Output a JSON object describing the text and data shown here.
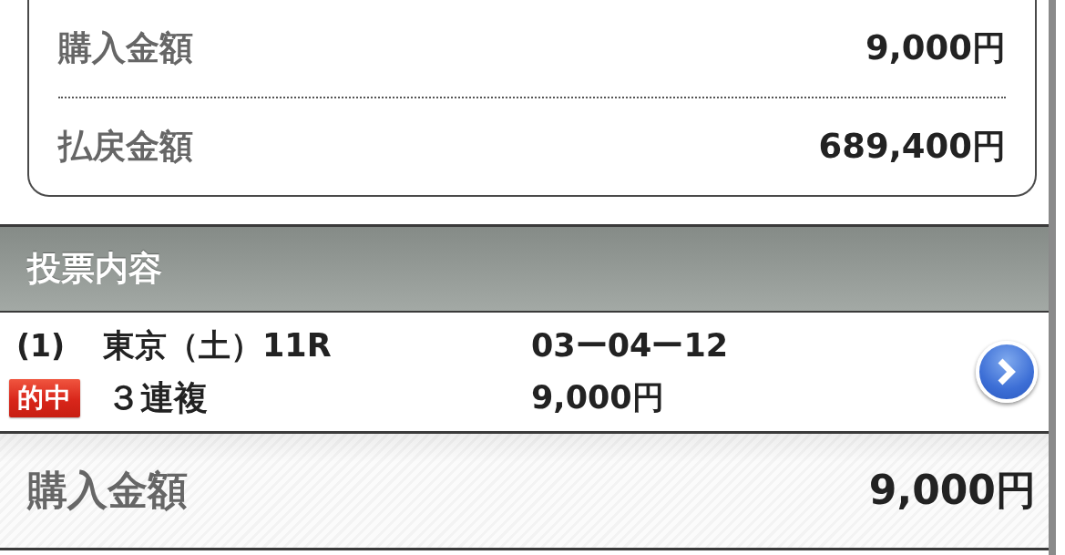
{
  "summary": [
    {
      "label": "購入金額",
      "value": "9,000円"
    },
    {
      "label": "払戻金額",
      "value": "689,400円"
    }
  ],
  "section": {
    "title": "投票内容"
  },
  "bets": [
    {
      "number": "(1)",
      "race": "東京（土）11R",
      "combination": "03ー04ー12",
      "result_badge": "的中",
      "bet_type": "３連複",
      "amount": "9,000円"
    }
  ],
  "total": {
    "label": "購入金額",
    "value": "9,000円"
  }
}
